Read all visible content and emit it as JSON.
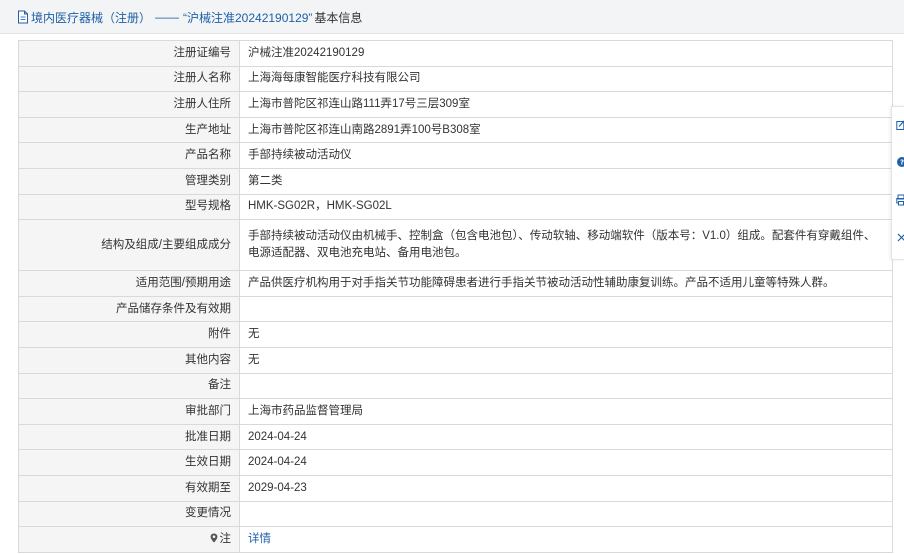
{
  "header": {
    "breadcrumb_link": "境内医疗器械（注册）",
    "separator": "——",
    "record_title": "“沪械注准20242190129”",
    "suffix": "基本信息"
  },
  "table": {
    "rows": [
      {
        "label": "注册证编号",
        "value": "沪械注准20242190129"
      },
      {
        "label": "注册人名称",
        "value": "上海海每康智能医疗科技有限公司"
      },
      {
        "label": "注册人住所",
        "value": "上海市普陀区祁连山路111弄17号三层309室"
      },
      {
        "label": "生产地址",
        "value": "上海市普陀区祁连山南路2891弄100号B308室"
      },
      {
        "label": "产品名称",
        "value": "手部持续被动活动仪"
      },
      {
        "label": "管理类别",
        "value": "第二类"
      },
      {
        "label": "型号规格",
        "value": "HMK-SG02R，HMK-SG02L"
      },
      {
        "label": "结构及组成/主要组成成分",
        "value": "手部持续被动活动仪由机械手、控制盒（包含电池包）、传动软轴、移动端软件（版本号：V1.0）组成。配套件有穿戴组件、电源适配器、双电池充电站、备用电池包。"
      },
      {
        "label": "适用范围/预期用途",
        "value": "产品供医疗机构用于对手指关节功能障碍患者进行手指关节被动活动性辅助康复训练。产品不适用儿童等特殊人群。"
      },
      {
        "label": "产品储存条件及有效期",
        "value": ""
      },
      {
        "label": "附件",
        "value": "无"
      },
      {
        "label": "其他内容",
        "value": "无"
      },
      {
        "label": "备注",
        "value": ""
      },
      {
        "label": "审批部门",
        "value": "上海市药品监督管理局"
      },
      {
        "label": "批准日期",
        "value": "2024-04-24"
      },
      {
        "label": "生效日期",
        "value": "2024-04-24"
      },
      {
        "label": "有效期至",
        "value": "2029-04-23"
      },
      {
        "label": "变更情况",
        "value": ""
      }
    ],
    "note_label": "注",
    "note_link": "详情"
  },
  "colors": {
    "link": "#1f5fa8",
    "label_bg": "#f5f5f5",
    "border": "#d9d9d9",
    "header_bg": "#f3f4f5"
  },
  "sidebar_icons": [
    "edit-icon",
    "help-icon",
    "print-icon",
    "close-icon"
  ]
}
